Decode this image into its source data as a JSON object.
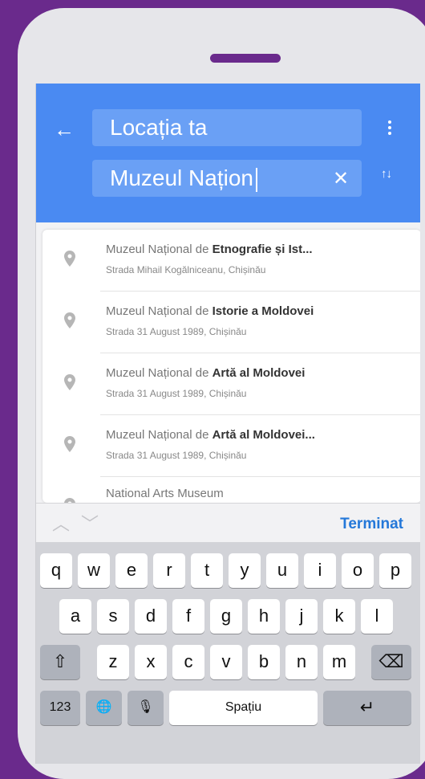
{
  "header": {
    "origin": "Locația ta",
    "destination": "Muzeul Națion",
    "clear_icon": "close-icon",
    "menu_icon": "more-vert-icon",
    "swap_icon": "swap-vertical-icon"
  },
  "results": [
    {
      "title_prefix": "Muzeul Național de ",
      "title_bold": "Etnografie și Ist...",
      "subtitle": "Strada Mihail Kogălniceanu, Chișinău"
    },
    {
      "title_prefix": "Muzeul Național de ",
      "title_bold": "Istorie a Moldovei",
      "subtitle": "Strada 31 August 1989, Chișinău"
    },
    {
      "title_prefix": "Muzeul Național de ",
      "title_bold": "Artă al Moldovei",
      "subtitle": "Strada 31 August 1989, Chișinău"
    },
    {
      "title_prefix": "Muzeul Național de ",
      "title_bold": "Artă al Moldovei...",
      "subtitle": "Strada 31 August 1989, Chișinău"
    },
    {
      "title_prefix": "National Arts Museum",
      "title_bold": "",
      "subtitle": ""
    }
  ],
  "keyboard": {
    "done_label": "Terminat",
    "row1": [
      "q",
      "w",
      "e",
      "r",
      "t",
      "y",
      "u",
      "i",
      "o",
      "p"
    ],
    "row2": [
      "a",
      "s",
      "d",
      "f",
      "g",
      "h",
      "j",
      "k",
      "l"
    ],
    "row3": [
      "z",
      "x",
      "c",
      "v",
      "b",
      "n",
      "m"
    ],
    "numbers_label": "123",
    "space_label": "Spațiu",
    "shift_symbol": "⇧",
    "delete_symbol": "⌫",
    "globe_symbol": "🌐",
    "mic_symbol": "🎙",
    "return_symbol": "↵",
    "prev_symbol": "︿",
    "next_symbol": "﹀"
  },
  "colors": {
    "header_blue": "#4a8af2",
    "accent": "#2478d9",
    "frame_purple": "#6a2a8c"
  }
}
